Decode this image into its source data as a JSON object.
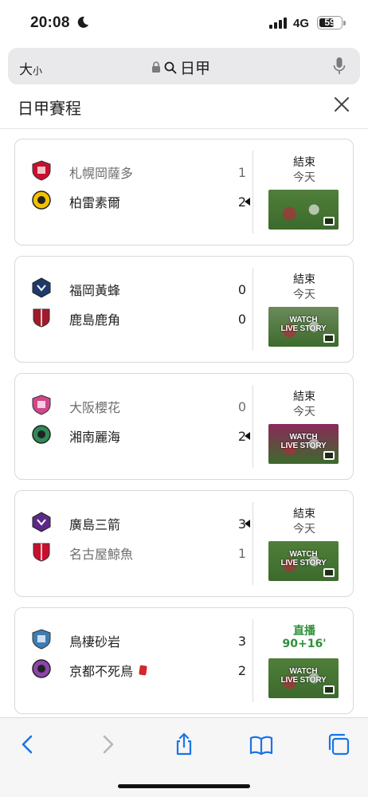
{
  "status_bar": {
    "time": "20:08",
    "network": "4G",
    "battery": "59"
  },
  "address_bar": {
    "text_size_label": "大",
    "text_size_small": "小",
    "url": "日甲"
  },
  "panel": {
    "title": "日甲賽程"
  },
  "matches": [
    {
      "home": {
        "name": "札幌岡薩多",
        "score": "1",
        "crest_color": "#c8102e"
      },
      "away": {
        "name": "柏雷素爾",
        "score": "2",
        "crest_color": "#f2c100"
      },
      "winner": "away",
      "status": "結束",
      "when": "今天",
      "live": false,
      "thumb_text": "",
      "thumb_color": "#4f7f3a"
    },
    {
      "home": {
        "name": "福岡黃蜂",
        "score": "0",
        "crest_color": "#1e3a6b"
      },
      "away": {
        "name": "鹿島鹿角",
        "score": "0",
        "crest_color": "#a01a2a"
      },
      "winner": "none",
      "status": "結束",
      "when": "今天",
      "live": false,
      "thumb_text": "WATCH\nLIVE STORY",
      "thumb_color": "#6b8b5a"
    },
    {
      "home": {
        "name": "大阪櫻花",
        "score": "0",
        "crest_color": "#d2468a"
      },
      "away": {
        "name": "湘南麗海",
        "score": "2",
        "crest_color": "#2e8b57"
      },
      "winner": "away",
      "status": "結束",
      "when": "今天",
      "live": false,
      "thumb_text": "WATCH\nLIVE STORY",
      "thumb_color": "#8a2a5a"
    },
    {
      "home": {
        "name": "廣島三箭",
        "score": "3",
        "crest_color": "#5b2a86"
      },
      "away": {
        "name": "名古屋鯨魚",
        "score": "1",
        "crest_color": "#c8102e"
      },
      "winner": "home",
      "status": "結束",
      "when": "今天",
      "live": false,
      "thumb_text": "WATCH\nLIVE STORY",
      "thumb_color": "#4f7f3a"
    },
    {
      "home": {
        "name": "鳥棲砂岩",
        "score": "3",
        "crest_color": "#3c7db3"
      },
      "away": {
        "name": "京都不死鳥",
        "score": "2",
        "crest_color": "#8e44ad",
        "red_card": true
      },
      "winner": "none",
      "status": "直播",
      "when": "90+16'",
      "live": true,
      "thumb_text": "WATCH\nLIVE STORY",
      "thumb_color": "#4f7f3a"
    }
  ],
  "toolbar": {
    "back": "chevron-left-icon",
    "forward": "chevron-right-icon",
    "share": "share-icon",
    "bookmarks": "book-icon",
    "tabs": "tabs-icon",
    "accent": "#1a73e8"
  }
}
